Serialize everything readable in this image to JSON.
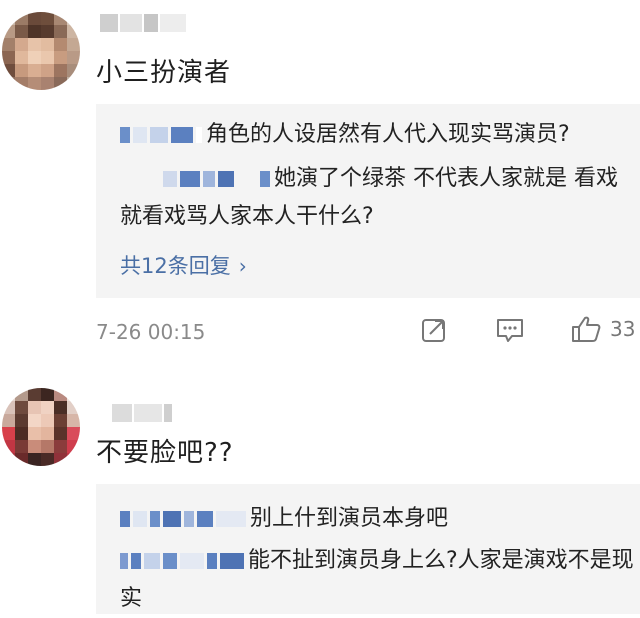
{
  "comments": [
    {
      "text": "小三扮演者",
      "replies": [
        "角色的人设居然有人代入现实骂演员?",
        "她演了个绿茶 不代表人家就是 看戏就看戏骂人家本人干什么?"
      ],
      "more_replies": "共12条回复",
      "timestamp": "7-26 00:15",
      "like_count": "33",
      "icons": [
        "share-icon",
        "comment-icon",
        "like-icon"
      ]
    },
    {
      "text": "不要脸吧??",
      "replies": [
        "别上什到演员本身吧",
        "能不扯到演员身上么?人家是演戏不是现实"
      ]
    }
  ],
  "colors": {
    "link": "#4a6fa5",
    "reply_bg": "#f4f4f4",
    "meta": "#8a8a8a"
  }
}
